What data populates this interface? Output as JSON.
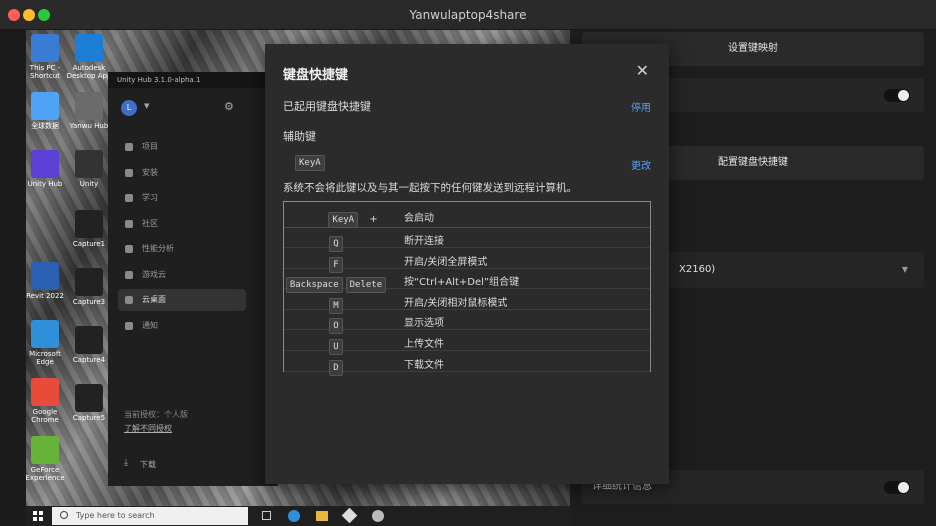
{
  "window": {
    "title": "Yanwulaptop4share"
  },
  "desktop": {
    "icons": [
      {
        "label": "This PC - Shortcut",
        "color": "#3a7bd5"
      },
      {
        "label": "Autodesk Desktop App",
        "color": "#1c7ed6"
      },
      {
        "label": "全球数据",
        "color": "#4fa3f7"
      },
      {
        "label": "Yanwu Hub",
        "color": "#6b6b6b"
      },
      {
        "label": "Unity Hub",
        "color": "#5b3fd6"
      },
      {
        "label": "Unity",
        "color": "#333333"
      },
      {
        "label": "Revit 2022",
        "color": "#2b5fb3"
      },
      {
        "label": "Microsoft Edge",
        "color": "#2f8fd8"
      },
      {
        "label": "Google Chrome",
        "color": "#e94a3a"
      },
      {
        "label": "GeForce Experience",
        "color": "#67b33a"
      },
      {
        "label": "Capture1",
        "color": "#222222"
      },
      {
        "label": "Capture3",
        "color": "#222222"
      },
      {
        "label": "Capture4",
        "color": "#222222"
      },
      {
        "label": "Capture5",
        "color": "#222222"
      }
    ]
  },
  "taskbar": {
    "search_placeholder": "Type here to search"
  },
  "unity_hub": {
    "title": "Unity Hub 3.1.0-alpha.1",
    "avatar": "L",
    "nav": [
      {
        "label": "项目",
        "icon": "cube-icon"
      },
      {
        "label": "安装",
        "icon": "lock-icon"
      },
      {
        "label": "学习",
        "icon": "graduation-icon"
      },
      {
        "label": "社区",
        "icon": "people-icon"
      },
      {
        "label": "性能分析",
        "icon": "bar-chart-icon"
      },
      {
        "label": "游戏云",
        "icon": "cloud-icon"
      },
      {
        "label": "云桌面",
        "icon": "desktop-icon"
      },
      {
        "label": "通知",
        "icon": "bell-icon"
      }
    ],
    "license_text": "当前授权：个人版",
    "license_link": "了解不同授权",
    "download_label": "下载"
  },
  "right_panel": {
    "key_mapping_button": "设置键映射",
    "configure_shortcuts_button": "配置键盘快捷键",
    "resolution_value": "X2160)",
    "stats_label": "详细统计信息"
  },
  "dialog": {
    "title": "键盘快捷键",
    "enabled_label": "已起用键盘快捷键",
    "disable_link": "停用",
    "modifier_label": "辅助键",
    "modifier_key": "KeyA",
    "change_link": "更改",
    "note": "系统不会将此键以及与其一起按下的任何键发送到远程计算机。",
    "header_key": "KeyA",
    "header_plus": "+",
    "header_desc": "会启动",
    "shortcuts": [
      {
        "keys": [
          "Q"
        ],
        "desc": "断开连接"
      },
      {
        "keys": [
          "F"
        ],
        "desc": "开启/关闭全屏模式"
      },
      {
        "keys": [
          "Backspace",
          "Delete"
        ],
        "desc": "按“Ctrl+Alt+Del”组合键"
      },
      {
        "keys": [
          "M"
        ],
        "desc": "开启/关闭相对鼠标模式"
      },
      {
        "keys": [
          "O"
        ],
        "desc": "显示选项"
      },
      {
        "keys": [
          "U"
        ],
        "desc": "上传文件"
      },
      {
        "keys": [
          "D"
        ],
        "desc": "下载文件"
      }
    ]
  }
}
